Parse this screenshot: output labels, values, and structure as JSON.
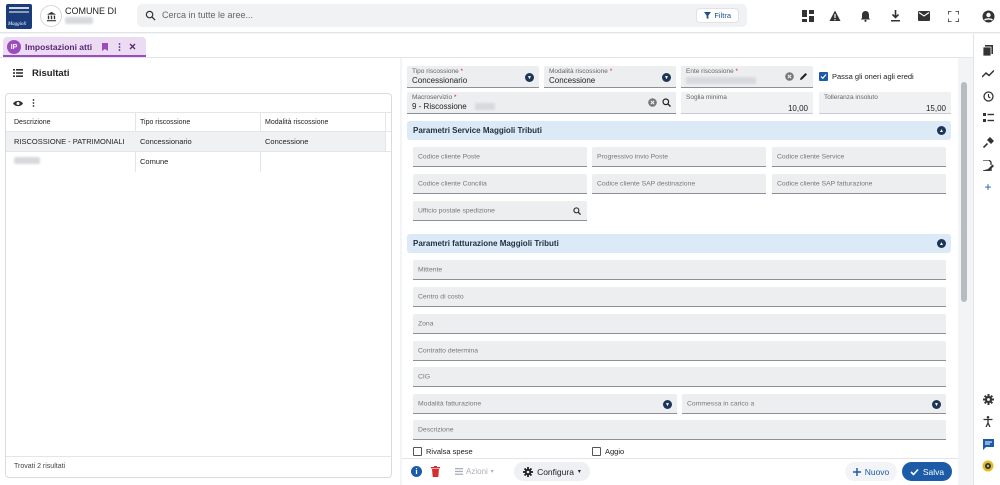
{
  "header": {
    "logo_text": "Maggioli",
    "comune_label": "COMUNE DI",
    "search_placeholder": "Cerca in tutte le aree...",
    "filter_label": "Filtra"
  },
  "tab": {
    "icon_text": "IP",
    "label": "Impostazioni atti"
  },
  "left": {
    "title": "Risultati",
    "columns": [
      "Descrizione",
      "Tipo riscossione",
      "Modalità riscossione"
    ],
    "rows": [
      {
        "descrizione": "RISCOSSIONE - PATRIMONIALI",
        "tipo": "Concessionario",
        "modalita": "Concessione"
      },
      {
        "descrizione": "",
        "tipo": "Comune",
        "modalita": ""
      }
    ],
    "footer": "Trovati 2 risultati"
  },
  "form": {
    "tipo_riscossione": {
      "label": "Tipo riscossione",
      "value": "Concessionario"
    },
    "modalita_riscossione": {
      "label": "Modalità riscossione",
      "value": "Concessione"
    },
    "ente_riscossione": {
      "label": "Ente riscossione"
    },
    "passa_oneri": {
      "label": "Passa gli oneri agli eredi",
      "checked": true
    },
    "macroservizio": {
      "label": "Macroservizio",
      "value": "9 - Riscossione"
    },
    "soglia_minima": {
      "label": "Soglia minima",
      "value": "10,00"
    },
    "tolleranza_insoluto": {
      "label": "Tolleranza insoluto",
      "value": "15,00"
    },
    "section_service": {
      "title": "Parametri Service Maggioli Tributi",
      "fields": [
        "Codice cliente Poste",
        "Progressivo invio Poste",
        "Codice cliente Service",
        "Codice cliente Concilia",
        "Codice cliente SAP destinazione",
        "Codice cliente SAP fatturazione"
      ],
      "ufficio_postale": "Ufficio postale spedizione"
    },
    "section_fatturazione": {
      "title": "Parametri fatturazione Maggioli Tributi",
      "mittente": "Mittente",
      "centro_costo": "Centro di costo",
      "zona": "Zona",
      "contratto": "Contratto determina",
      "cig": "CIG",
      "modalita_fatturazione": "Modalità fatturazione",
      "commessa": "Commessa in carico a",
      "descrizione": "Descrizione",
      "rivalsa_spese": "Rivalsa spese",
      "aggio": "Aggio"
    }
  },
  "bottom": {
    "azioni_label": "Azioni",
    "configura_label": "Configura",
    "nuovo_label": "Nuovo",
    "salva_label": "Salva"
  },
  "colors": {
    "primary": "#1c5ba8",
    "tab_accent": "#9b4dbf",
    "section_bg": "#dce9f6",
    "delete": "#d32f2f",
    "info": "#1c5ba8"
  }
}
